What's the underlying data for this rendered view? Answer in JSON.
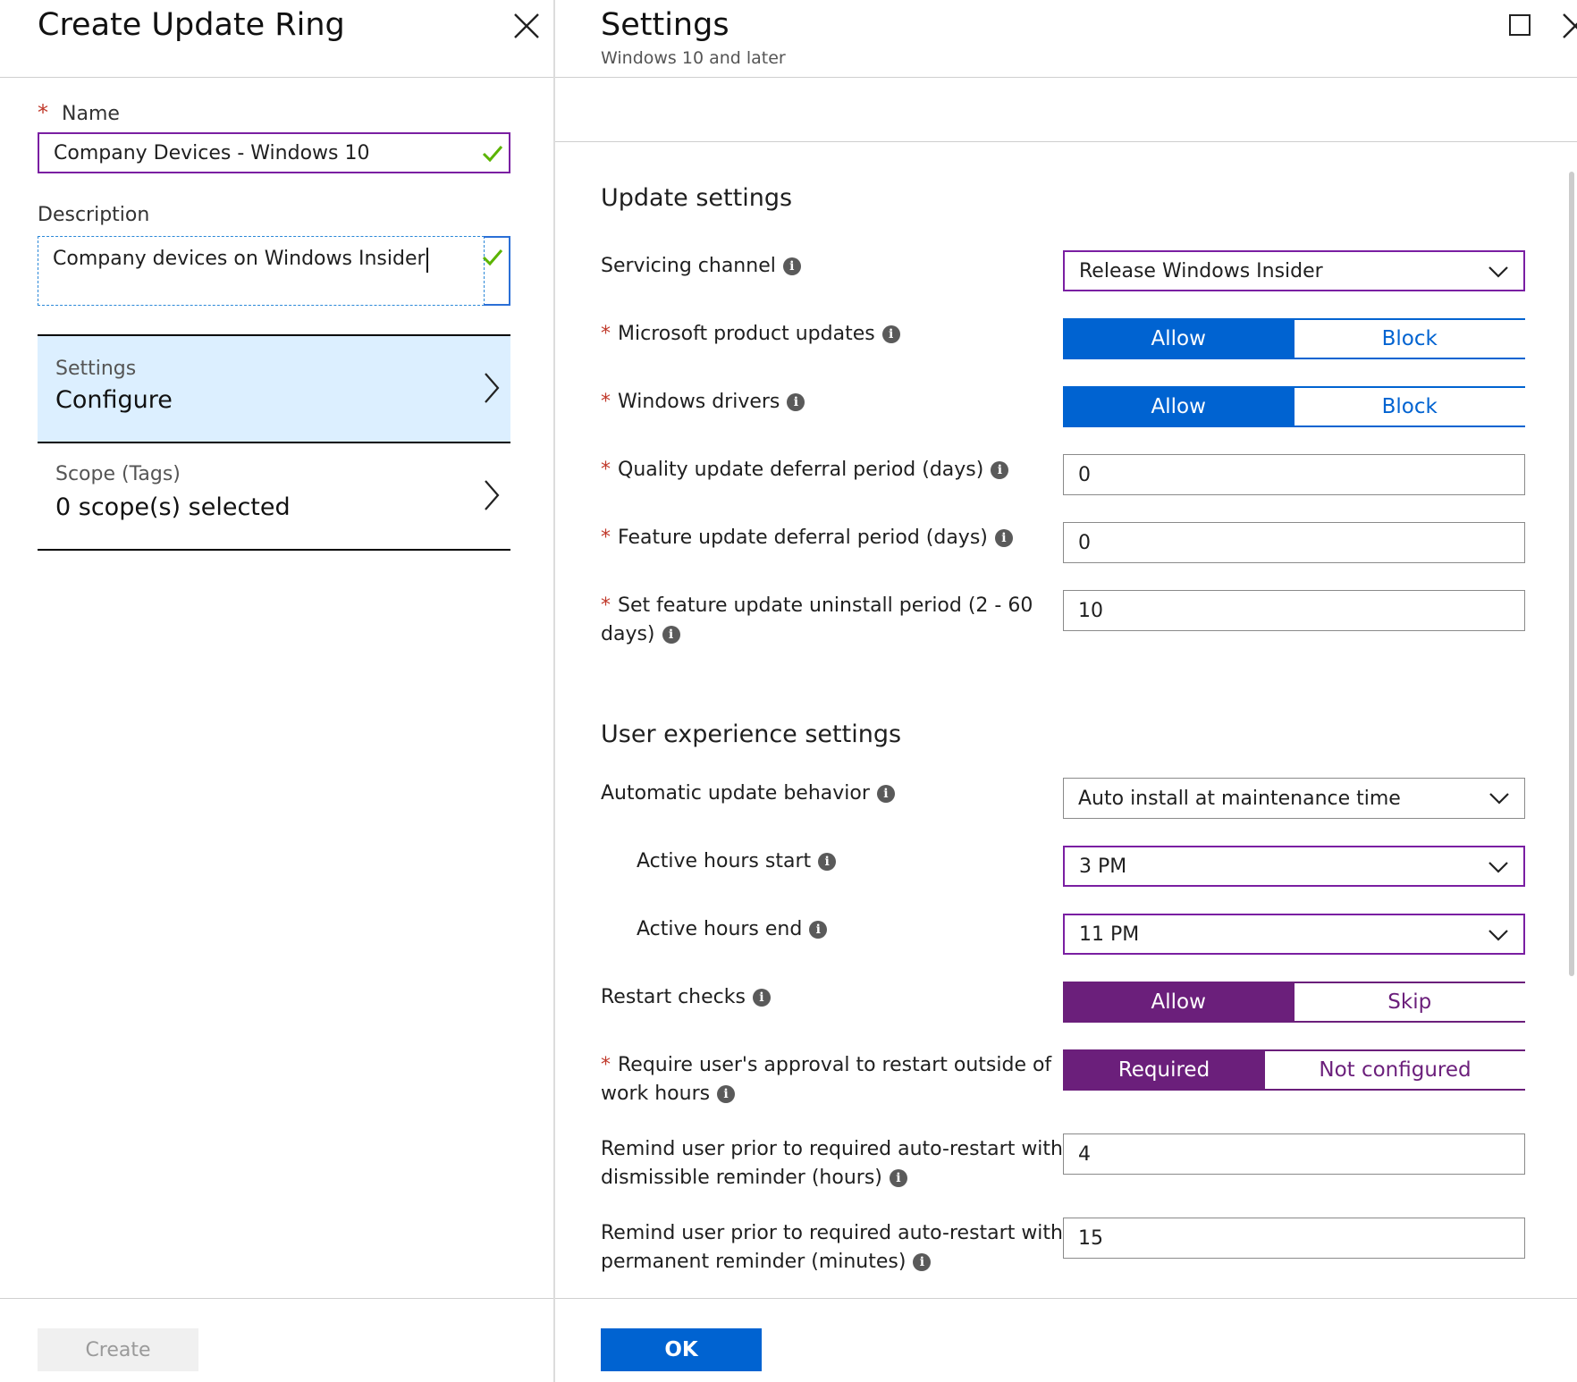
{
  "left_blade": {
    "title": "Create Update Ring",
    "name_label": "Name",
    "name_value": "Company Devices - Windows 10",
    "description_label": "Description",
    "description_value": "Company devices on Windows Insider",
    "nav": [
      {
        "sub": "Settings",
        "main": "Configure"
      },
      {
        "sub": "Scope (Tags)",
        "main": "0 scope(s) selected"
      }
    ],
    "create_label": "Create"
  },
  "right_blade": {
    "title": "Settings",
    "subtitle": "Windows 10 and later",
    "update_section": "Update settings",
    "servicing_channel": {
      "label": "Servicing channel",
      "value": "Release Windows Insider"
    },
    "ms_product_updates": {
      "label": "Microsoft product updates",
      "on": "Allow",
      "off": "Block"
    },
    "windows_drivers": {
      "label": "Windows drivers",
      "on": "Allow",
      "off": "Block"
    },
    "quality_deferral": {
      "label": "Quality update deferral period (days)",
      "value": "0"
    },
    "feature_deferral": {
      "label": "Feature update deferral period (days)",
      "value": "0"
    },
    "uninstall_period": {
      "label_line1": "Set feature update uninstall period (2 - 60",
      "label_line2": "days)",
      "value": "10"
    },
    "ux_section": "User experience settings",
    "auto_update": {
      "label": "Automatic update behavior",
      "value": "Auto install at maintenance time"
    },
    "active_start": {
      "label": "Active hours start",
      "value": "3 PM"
    },
    "active_end": {
      "label": "Active hours end",
      "value": "11 PM"
    },
    "restart_checks": {
      "label": "Restart checks",
      "on": "Allow",
      "off": "Skip"
    },
    "require_approval": {
      "label_line1": "Require user's approval to restart outside of",
      "label_line2": "work hours",
      "on": "Required",
      "off": "Not configured"
    },
    "remind_dismissible": {
      "label_line1": "Remind user prior to required auto-restart with",
      "label_line2": "dismissible reminder (hours)",
      "value": "4"
    },
    "remind_permanent": {
      "label_line1": "Remind user prior to required auto-restart with",
      "label_line2": "permanent reminder (minutes)",
      "value": "15"
    },
    "ok_label": "OK"
  },
  "icons": {
    "info_glyph": "i",
    "required_marker": "*"
  },
  "colors": {
    "accent_blue": "#0063d1",
    "accent_purple": "#6b1f7b",
    "selected_nav_bg": "#dcefff",
    "valid_check": "#5bb400"
  }
}
